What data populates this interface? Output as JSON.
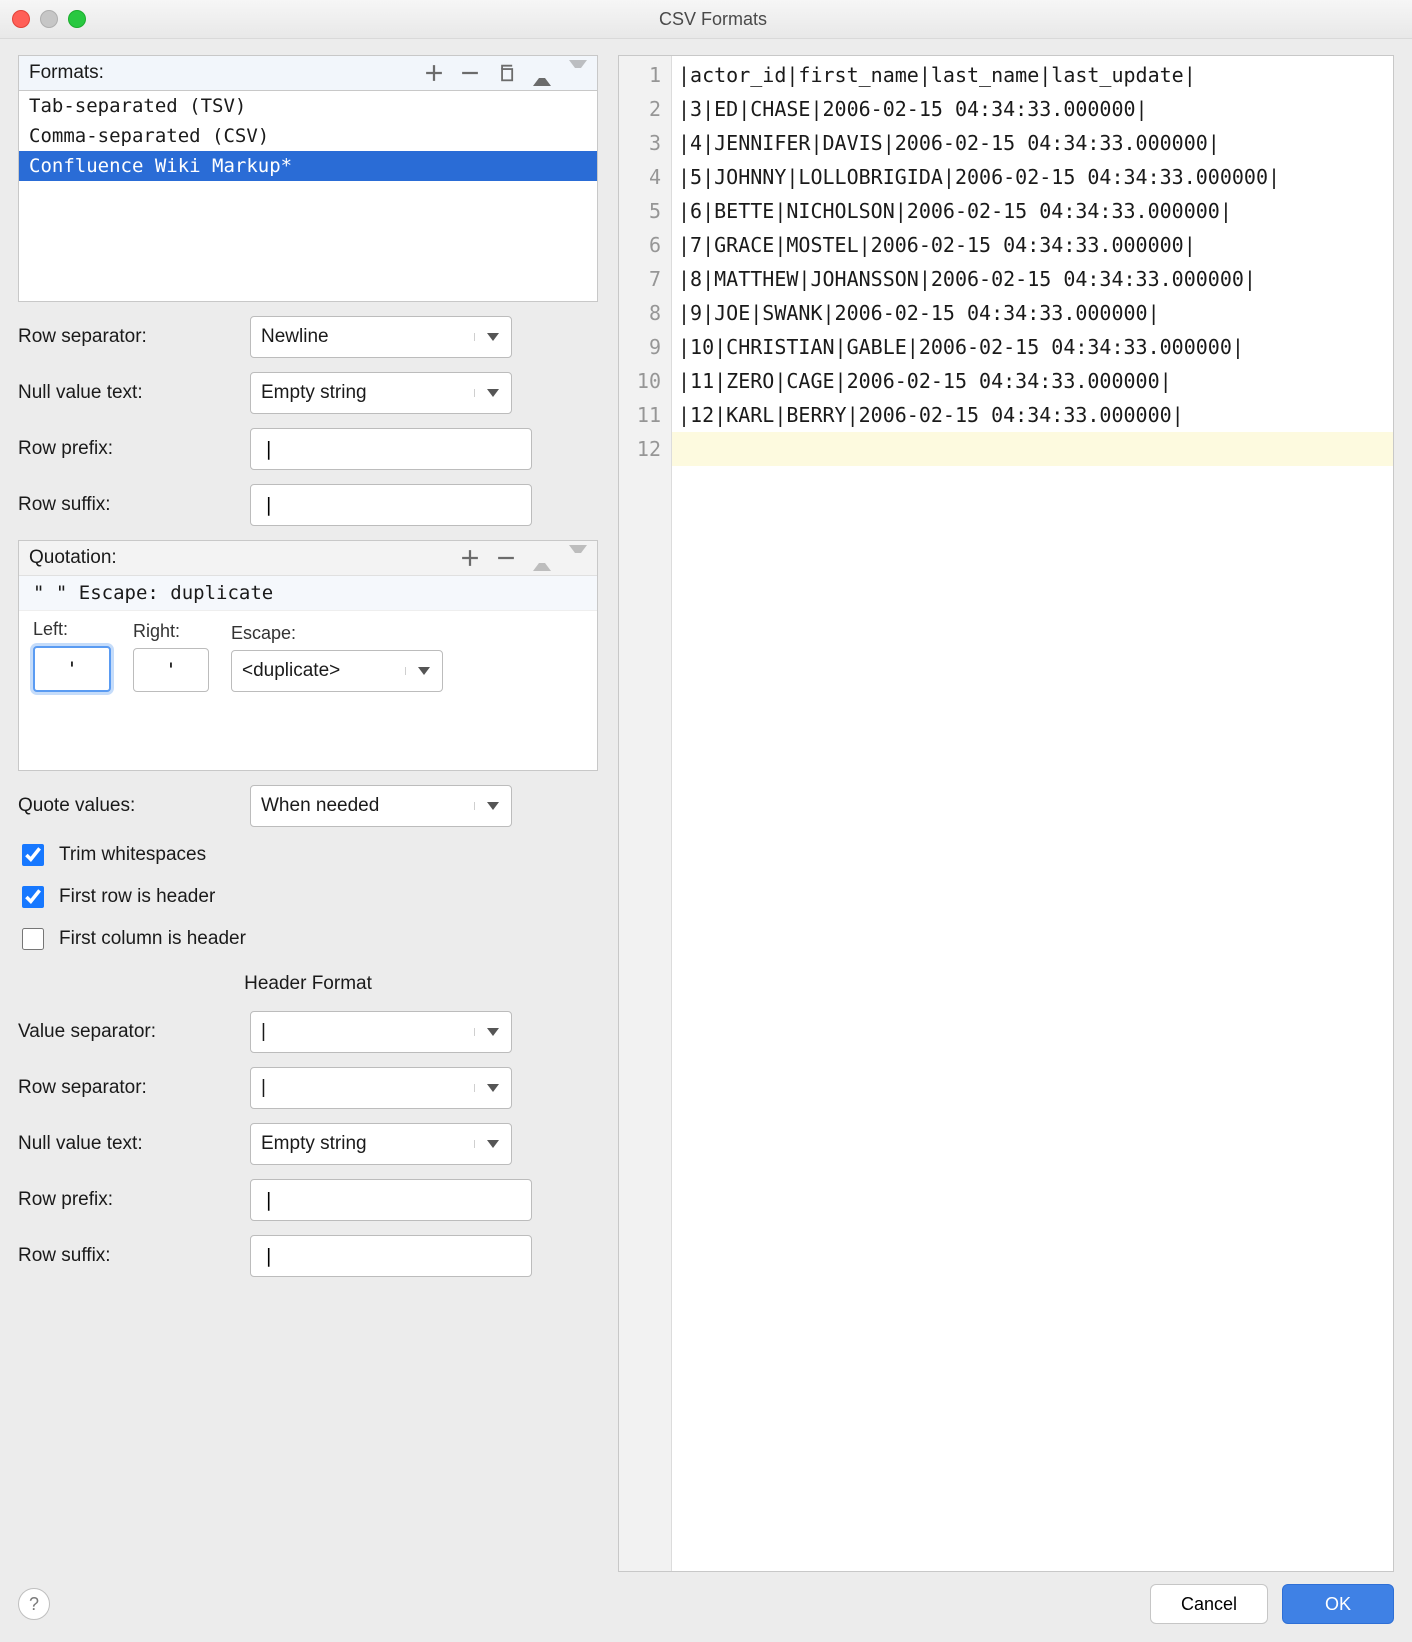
{
  "window": {
    "title": "CSV Formats"
  },
  "formats": {
    "label": "Formats:",
    "items": [
      {
        "label": "Tab-separated (TSV)",
        "selected": false
      },
      {
        "label": "Comma-separated (CSV)",
        "selected": false
      },
      {
        "label": "Confluence Wiki Markup*",
        "selected": true
      }
    ]
  },
  "fields": {
    "row_separator_label": "Row separator:",
    "row_separator_value": "Newline",
    "null_text_label": "Null value text:",
    "null_text_value": "Empty string",
    "row_prefix_label": "Row prefix:",
    "row_prefix_value": "|",
    "row_suffix_label": "Row suffix:",
    "row_suffix_value": "|"
  },
  "quotation": {
    "label": "Quotation:",
    "summary": "\"  \"  Escape: duplicate",
    "left_label": "Left:",
    "left_value": "'",
    "right_label": "Right:",
    "right_value": "'",
    "escape_label": "Escape:",
    "escape_value": "<duplicate>"
  },
  "quote_values_label": "Quote values:",
  "quote_values_value": "When needed",
  "checks": {
    "trim_label": "Trim whitespaces",
    "trim_checked": true,
    "first_row_header_label": "First row is header",
    "first_row_header_checked": true,
    "first_col_header_label": "First column is header",
    "first_col_header_checked": false
  },
  "header_format": {
    "title": "Header Format",
    "value_sep_label": "Value separator:",
    "value_sep_value": "|",
    "row_sep_label": "Row separator:",
    "row_sep_value": "|",
    "null_text_label": "Null value text:",
    "null_text_value": "Empty string",
    "row_prefix_label": "Row prefix:",
    "row_prefix_value": "|",
    "row_suffix_label": "Row suffix:",
    "row_suffix_value": "|"
  },
  "preview": {
    "lines": [
      "|actor_id|first_name|last_name|last_update|",
      "|3|ED|CHASE|2006-02-15 04:34:33.000000|",
      "|4|JENNIFER|DAVIS|2006-02-15 04:34:33.000000|",
      "|5|JOHNNY|LOLLOBRIGIDA|2006-02-15 04:34:33.000000|",
      "|6|BETTE|NICHOLSON|2006-02-15 04:34:33.000000|",
      "|7|GRACE|MOSTEL|2006-02-15 04:34:33.000000|",
      "|8|MATTHEW|JOHANSSON|2006-02-15 04:34:33.000000|",
      "|9|JOE|SWANK|2006-02-15 04:34:33.000000|",
      "|10|CHRISTIAN|GABLE|2006-02-15 04:34:33.000000|",
      "|11|ZERO|CAGE|2006-02-15 04:34:33.000000|",
      "|12|KARL|BERRY|2006-02-15 04:34:33.000000|",
      ""
    ]
  },
  "buttons": {
    "cancel": "Cancel",
    "ok": "OK"
  }
}
